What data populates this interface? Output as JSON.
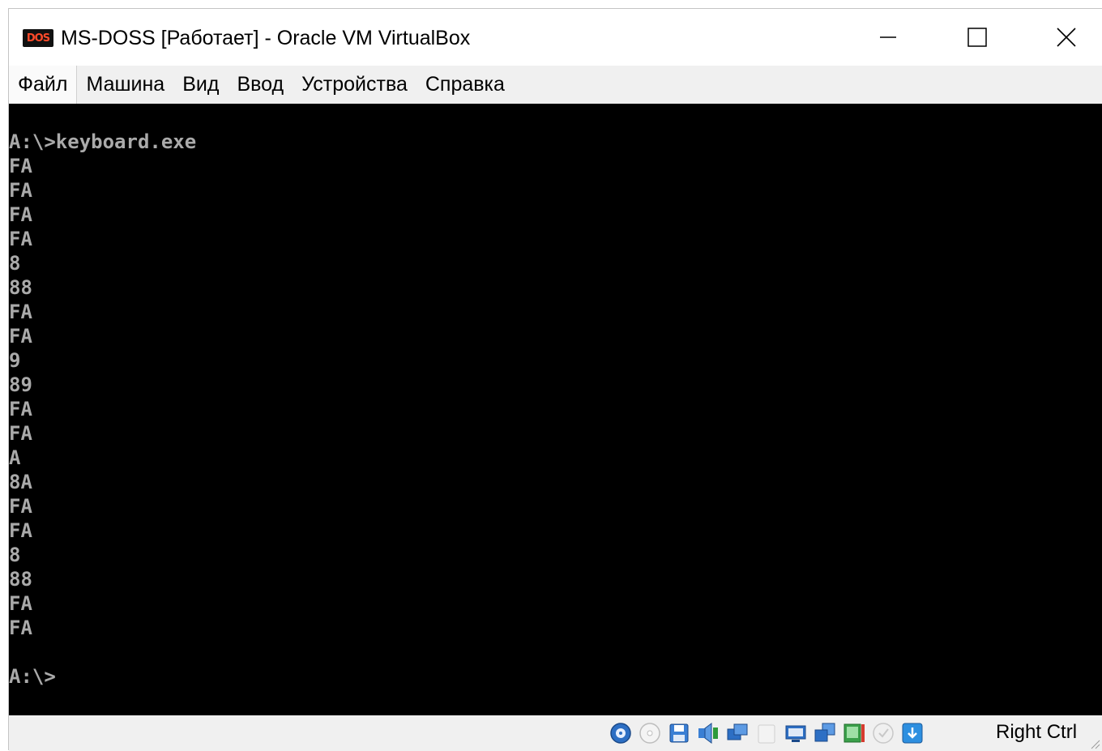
{
  "window": {
    "icon_text": "DOS",
    "title": "MS-DOSS [Работает] - Oracle VM VirtualBox"
  },
  "menu": {
    "items": [
      "Файл",
      "Машина",
      "Вид",
      "Ввод",
      "Устройства",
      "Справка"
    ]
  },
  "console": {
    "lines": [
      "A:\\>keyboard.exe",
      "FA",
      "FA",
      "FA",
      "FA",
      "8",
      "88",
      "FA",
      "FA",
      "9",
      "89",
      "FA",
      "FA",
      "A",
      "8A",
      "FA",
      "FA",
      "8",
      "88",
      "FA",
      "FA",
      "",
      "A:\\>"
    ]
  },
  "statusbar": {
    "icons": [
      "hard-disk-icon",
      "optical-drive-icon",
      "floppy-drive-icon",
      "audio-icon",
      "network-icon",
      "usb-icon",
      "shared-folders-icon",
      "display-icon",
      "recording-icon",
      "cpu-activity-icon",
      "mouse-integration-icon",
      "keyboard-capture-icon"
    ],
    "host_key": "Right Ctrl"
  },
  "colors": {
    "console_background": "#000000",
    "console_text": "#aaaaaa",
    "menubar": "#f0f0f0"
  }
}
